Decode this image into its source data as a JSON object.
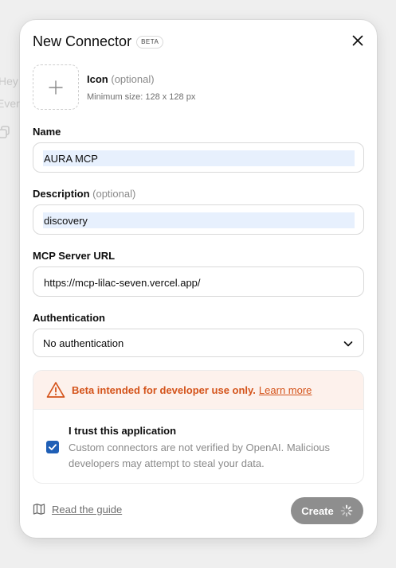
{
  "background": {
    "text_1": "Hey",
    "text_2": "Ever"
  },
  "modal": {
    "title": "New Connector",
    "badge": "BETA",
    "close_icon": "close-icon"
  },
  "icon_field": {
    "label": "Icon",
    "optional": "(optional)",
    "hint": "Minimum size: 128 x 128 px",
    "upload_icon": "plus-icon"
  },
  "name_field": {
    "label": "Name",
    "value": "AURA MCP"
  },
  "description_field": {
    "label": "Description",
    "optional": "(optional)",
    "value": "discovery"
  },
  "url_field": {
    "label": "MCP Server URL",
    "value": "https://mcp-lilac-seven.vercel.app/"
  },
  "auth_field": {
    "label": "Authentication",
    "selected": "No authentication"
  },
  "warning": {
    "text": "Beta intended for developer use only.",
    "link": "Learn more",
    "icon": "warning-triangle-icon",
    "trust_title": "I trust this application",
    "trust_desc": "Custom connectors are not verified by OpenAI. Malicious developers may attempt to steal your data.",
    "checked": true
  },
  "footer": {
    "guide_label": "Read the guide",
    "guide_icon": "book-icon",
    "create_label": "Create"
  },
  "colors": {
    "accent": "#1f5fb6",
    "warning": "#d4531a",
    "warning_bg": "#fdf1ec",
    "button_disabled": "#8e8e8e"
  }
}
